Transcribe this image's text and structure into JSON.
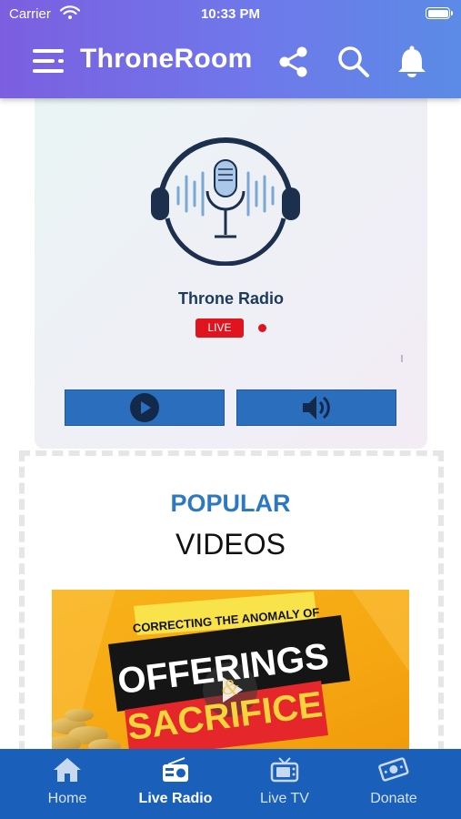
{
  "status_bar": {
    "carrier": "Carrier",
    "time": "10:33 PM"
  },
  "header": {
    "title": "ThroneRoom",
    "icons": [
      "menu-icon",
      "share-icon",
      "search-icon",
      "bell-icon"
    ]
  },
  "radio": {
    "station": "Throne Radio",
    "badge": "LIVE",
    "live_color": "#e0141e",
    "controls": [
      "play-icon",
      "volume-icon"
    ]
  },
  "popular": {
    "heading_top": "POPULAR",
    "heading_bottom": "VIDEOS",
    "video": {
      "banner_top": "CORRECTING THE ANOMALY OF",
      "line1": "OFFERINGS",
      "amp": "&",
      "line2": "SACRIFICE"
    }
  },
  "tabs": [
    {
      "label": "Home",
      "icon": "home-icon",
      "active": false
    },
    {
      "label": "Live Radio",
      "icon": "radio-icon",
      "active": true
    },
    {
      "label": "Live TV",
      "icon": "tv-icon",
      "active": false
    },
    {
      "label": "Donate",
      "icon": "donate-icon",
      "active": false
    }
  ],
  "colors": {
    "accent": "#2a6ebd",
    "tabbar": "#1a5fba",
    "header_start": "#7b5fe0",
    "header_end": "#5b8be6",
    "popular": "#2c79c0"
  }
}
